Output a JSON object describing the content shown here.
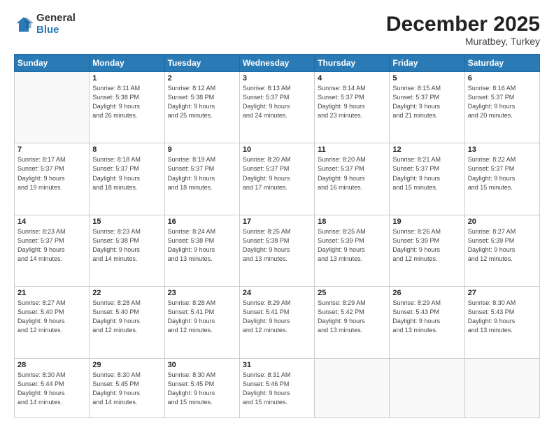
{
  "logo": {
    "general": "General",
    "blue": "Blue"
  },
  "header": {
    "month": "December 2025",
    "location": "Muratbey, Turkey"
  },
  "weekdays": [
    "Sunday",
    "Monday",
    "Tuesday",
    "Wednesday",
    "Thursday",
    "Friday",
    "Saturday"
  ],
  "weeks": [
    [
      {
        "day": "",
        "info": ""
      },
      {
        "day": "1",
        "info": "Sunrise: 8:11 AM\nSunset: 5:38 PM\nDaylight: 9 hours\nand 26 minutes."
      },
      {
        "day": "2",
        "info": "Sunrise: 8:12 AM\nSunset: 5:38 PM\nDaylight: 9 hours\nand 25 minutes."
      },
      {
        "day": "3",
        "info": "Sunrise: 8:13 AM\nSunset: 5:37 PM\nDaylight: 9 hours\nand 24 minutes."
      },
      {
        "day": "4",
        "info": "Sunrise: 8:14 AM\nSunset: 5:37 PM\nDaylight: 9 hours\nand 23 minutes."
      },
      {
        "day": "5",
        "info": "Sunrise: 8:15 AM\nSunset: 5:37 PM\nDaylight: 9 hours\nand 21 minutes."
      },
      {
        "day": "6",
        "info": "Sunrise: 8:16 AM\nSunset: 5:37 PM\nDaylight: 9 hours\nand 20 minutes."
      }
    ],
    [
      {
        "day": "7",
        "info": "Sunrise: 8:17 AM\nSunset: 5:37 PM\nDaylight: 9 hours\nand 19 minutes."
      },
      {
        "day": "8",
        "info": "Sunrise: 8:18 AM\nSunset: 5:37 PM\nDaylight: 9 hours\nand 18 minutes."
      },
      {
        "day": "9",
        "info": "Sunrise: 8:19 AM\nSunset: 5:37 PM\nDaylight: 9 hours\nand 18 minutes."
      },
      {
        "day": "10",
        "info": "Sunrise: 8:20 AM\nSunset: 5:37 PM\nDaylight: 9 hours\nand 17 minutes."
      },
      {
        "day": "11",
        "info": "Sunrise: 8:20 AM\nSunset: 5:37 PM\nDaylight: 9 hours\nand 16 minutes."
      },
      {
        "day": "12",
        "info": "Sunrise: 8:21 AM\nSunset: 5:37 PM\nDaylight: 9 hours\nand 15 minutes."
      },
      {
        "day": "13",
        "info": "Sunrise: 8:22 AM\nSunset: 5:37 PM\nDaylight: 9 hours\nand 15 minutes."
      }
    ],
    [
      {
        "day": "14",
        "info": "Sunrise: 8:23 AM\nSunset: 5:37 PM\nDaylight: 9 hours\nand 14 minutes."
      },
      {
        "day": "15",
        "info": "Sunrise: 8:23 AM\nSunset: 5:38 PM\nDaylight: 9 hours\nand 14 minutes."
      },
      {
        "day": "16",
        "info": "Sunrise: 8:24 AM\nSunset: 5:38 PM\nDaylight: 9 hours\nand 13 minutes."
      },
      {
        "day": "17",
        "info": "Sunrise: 8:25 AM\nSunset: 5:38 PM\nDaylight: 9 hours\nand 13 minutes."
      },
      {
        "day": "18",
        "info": "Sunrise: 8:25 AM\nSunset: 5:39 PM\nDaylight: 9 hours\nand 13 minutes."
      },
      {
        "day": "19",
        "info": "Sunrise: 8:26 AM\nSunset: 5:39 PM\nDaylight: 9 hours\nand 12 minutes."
      },
      {
        "day": "20",
        "info": "Sunrise: 8:27 AM\nSunset: 5:39 PM\nDaylight: 9 hours\nand 12 minutes."
      }
    ],
    [
      {
        "day": "21",
        "info": "Sunrise: 8:27 AM\nSunset: 5:40 PM\nDaylight: 9 hours\nand 12 minutes."
      },
      {
        "day": "22",
        "info": "Sunrise: 8:28 AM\nSunset: 5:40 PM\nDaylight: 9 hours\nand 12 minutes."
      },
      {
        "day": "23",
        "info": "Sunrise: 8:28 AM\nSunset: 5:41 PM\nDaylight: 9 hours\nand 12 minutes."
      },
      {
        "day": "24",
        "info": "Sunrise: 8:29 AM\nSunset: 5:41 PM\nDaylight: 9 hours\nand 12 minutes."
      },
      {
        "day": "25",
        "info": "Sunrise: 8:29 AM\nSunset: 5:42 PM\nDaylight: 9 hours\nand 13 minutes."
      },
      {
        "day": "26",
        "info": "Sunrise: 8:29 AM\nSunset: 5:43 PM\nDaylight: 9 hours\nand 13 minutes."
      },
      {
        "day": "27",
        "info": "Sunrise: 8:30 AM\nSunset: 5:43 PM\nDaylight: 9 hours\nand 13 minutes."
      }
    ],
    [
      {
        "day": "28",
        "info": "Sunrise: 8:30 AM\nSunset: 5:44 PM\nDaylight: 9 hours\nand 14 minutes."
      },
      {
        "day": "29",
        "info": "Sunrise: 8:30 AM\nSunset: 5:45 PM\nDaylight: 9 hours\nand 14 minutes."
      },
      {
        "day": "30",
        "info": "Sunrise: 8:30 AM\nSunset: 5:45 PM\nDaylight: 9 hours\nand 15 minutes."
      },
      {
        "day": "31",
        "info": "Sunrise: 8:31 AM\nSunset: 5:46 PM\nDaylight: 9 hours\nand 15 minutes."
      },
      {
        "day": "",
        "info": ""
      },
      {
        "day": "",
        "info": ""
      },
      {
        "day": "",
        "info": ""
      }
    ]
  ]
}
